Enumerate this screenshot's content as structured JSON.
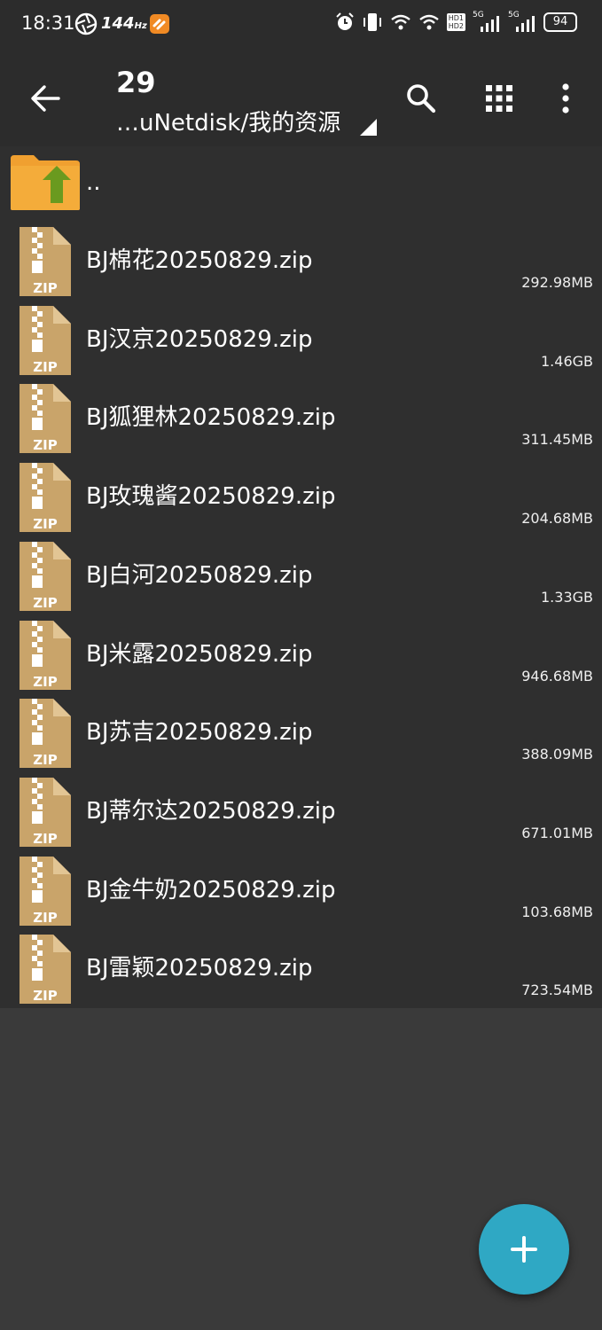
{
  "status": {
    "time": "18:31",
    "refresh_rate": "144",
    "refresh_unit": "Hz",
    "network_labels": [
      "HD1",
      "HD2",
      "5G",
      "5G"
    ],
    "battery": "94"
  },
  "toolbar": {
    "title": "29",
    "path": "…uNetdisk/我的资源"
  },
  "list": {
    "parent_label": "..",
    "icon_text": "ZIP",
    "files": [
      {
        "name": "BJ棉花20250829.zip",
        "size": "292.98MB"
      },
      {
        "name": "BJ汉京20250829.zip",
        "size": "1.46GB"
      },
      {
        "name": "BJ狐狸林20250829.zip",
        "size": "311.45MB"
      },
      {
        "name": "BJ玫瑰酱20250829.zip",
        "size": "204.68MB"
      },
      {
        "name": "BJ白河20250829.zip",
        "size": "1.33GB"
      },
      {
        "name": "BJ米露20250829.zip",
        "size": "946.68MB"
      },
      {
        "name": "BJ苏吉20250829.zip",
        "size": "388.09MB"
      },
      {
        "name": "BJ蒂尔达20250829.zip",
        "size": "671.01MB"
      },
      {
        "name": "BJ金牛奶20250829.zip",
        "size": "103.68MB"
      },
      {
        "name": "BJ雷颖20250829.zip",
        "size": "723.54MB"
      }
    ]
  },
  "colors": {
    "background": "#3a3a3a",
    "toolbar": "#2c2c2c",
    "list": "#2f2f2f",
    "fab": "#2fa8c4",
    "zip_icon": "#c9a46a",
    "folder": "#f0a030",
    "folder_arrow": "#6a9a1f"
  }
}
